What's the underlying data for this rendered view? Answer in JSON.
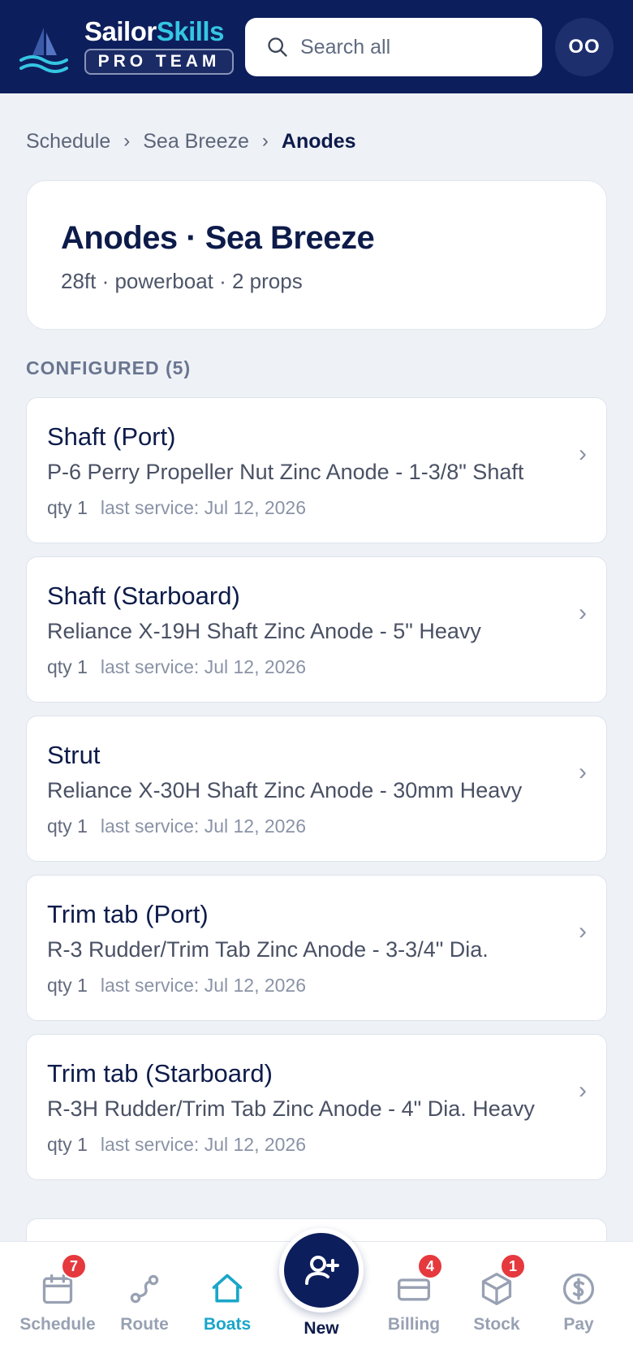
{
  "header": {
    "brand_primary": "Sailor",
    "brand_secondary": "Skills",
    "brand_tag": "PRO TEAM",
    "search_placeholder": "Search all",
    "avatar_initials": "OO"
  },
  "breadcrumb": {
    "items": [
      "Schedule",
      "Sea Breeze"
    ],
    "current": "Anodes",
    "separator": "›"
  },
  "boat": {
    "title": "Anodes · Sea Breeze",
    "subtitle": "28ft · powerboat · 2 props"
  },
  "section": {
    "label": "CONFIGURED (5)"
  },
  "anodes": [
    {
      "name": "Shaft (Port)",
      "product": "P-6 Perry Propeller Nut Zinc Anode - 1-3/8\" Shaft",
      "qty": "qty 1",
      "last_service": "last service: Jul 12, 2026"
    },
    {
      "name": "Shaft (Starboard)",
      "product": "Reliance X-19H Shaft Zinc Anode - 5\" Heavy",
      "qty": "qty 1",
      "last_service": "last service: Jul 12, 2026"
    },
    {
      "name": "Strut",
      "product": "Reliance X-30H Shaft Zinc Anode - 30mm Heavy",
      "qty": "qty 1",
      "last_service": "last service: Jul 12, 2026"
    },
    {
      "name": "Trim tab (Port)",
      "product": "R-3 Rudder/Trim Tab Zinc Anode - 3-3/4\" Dia.",
      "qty": "qty 1",
      "last_service": "last service: Jul 12, 2026"
    },
    {
      "name": "Trim tab (Starboard)",
      "product": "R-3H Rudder/Trim Tab Zinc Anode - 4\" Dia. Heavy",
      "qty": "qty 1",
      "last_service": "last service: Jul 12, 2026"
    }
  ],
  "chevron": "›",
  "nav": {
    "schedule": {
      "label": "Schedule",
      "badge": "7",
      "icon": "calendar-icon"
    },
    "route": {
      "label": "Route",
      "icon": "route-icon"
    },
    "boats": {
      "label": "Boats",
      "icon": "home-icon"
    },
    "new": {
      "label": "New",
      "icon": "add-user-icon"
    },
    "billing": {
      "label": "Billing",
      "badge": "4",
      "icon": "credit-card-icon"
    },
    "stock": {
      "label": "Stock",
      "badge": "1",
      "icon": "box-icon"
    },
    "pay": {
      "label": "Pay",
      "icon": "dollar-icon"
    }
  },
  "colors": {
    "header_bg": "#0d1e5c",
    "accent": "#35c6e3",
    "active_nav": "#1aa6c9",
    "badge": "#e5393e",
    "page_bg": "#eef1f6"
  }
}
